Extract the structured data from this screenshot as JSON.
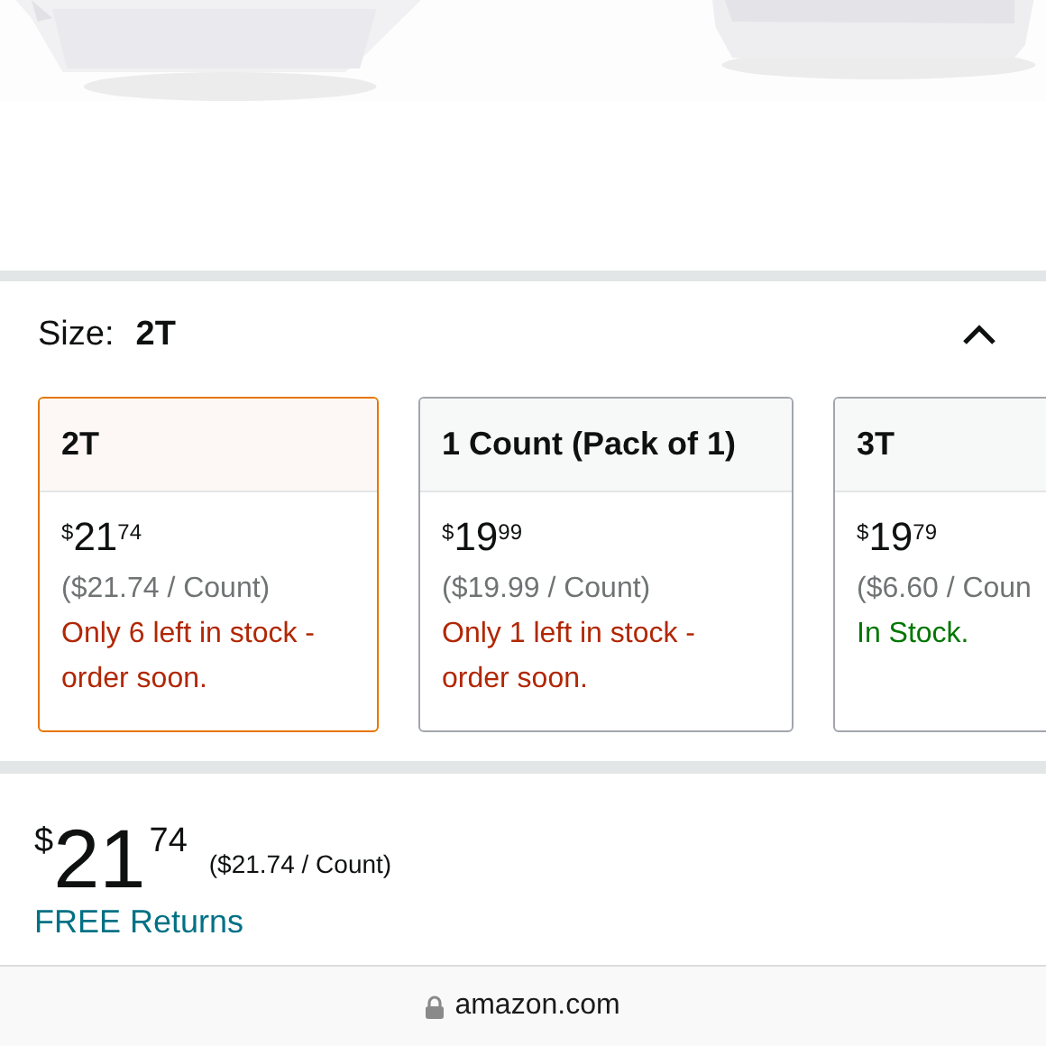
{
  "size_selector": {
    "label": "Size:",
    "value": "2T",
    "expanded": true,
    "options": [
      {
        "label": "2T",
        "selected": true,
        "currency": "$",
        "whole": "21",
        "fraction": "74",
        "unit_price": "($21.74 / Count)",
        "availability": "Only 6 left in stock - order soon.",
        "color": "#b12704"
      },
      {
        "label": "1 Count (Pack of 1)",
        "selected": false,
        "currency": "$",
        "whole": "19",
        "fraction": "99",
        "unit_price": "($19.99 / Count)",
        "availability": "Only 1 left in stock - order soon.",
        "color": "#b12704"
      },
      {
        "label": "3T",
        "selected": false,
        "currency": "$",
        "whole": "19",
        "fraction": "79",
        "unit_price": "($6.60 / Coun",
        "availability": "In Stock.",
        "color": "#007600"
      }
    ]
  },
  "price": {
    "currency": "$",
    "whole": "21",
    "fraction": "74",
    "unit_price": "($21.74 / Count)"
  },
  "returns_link": "FREE Returns",
  "address_bar": {
    "url": "amazon.com"
  }
}
